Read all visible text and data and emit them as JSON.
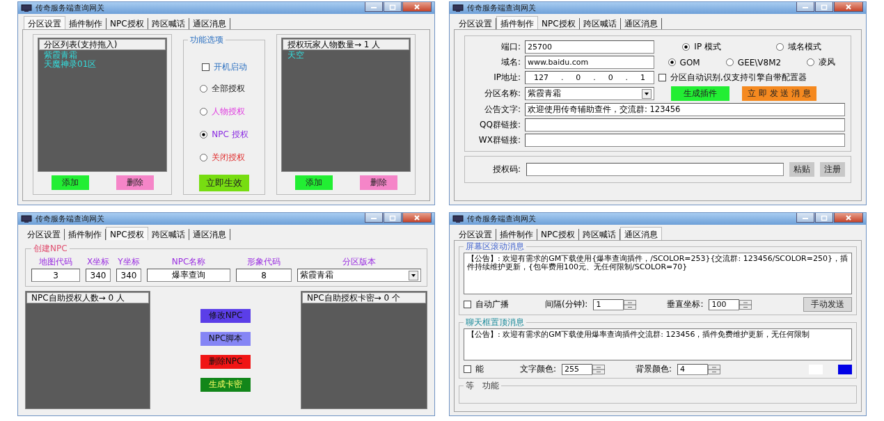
{
  "windows": [
    {
      "kind": "partition",
      "title": "传奇服务端查询网关",
      "tabs": [
        {
          "label": "分区设置",
          "selected": true
        },
        {
          "label": "插件制作",
          "selected": false
        },
        {
          "label": "NPC授权",
          "selected": false
        },
        {
          "label": "跨区喊话",
          "selected": false
        },
        {
          "label": "通区消息",
          "selected": false
        }
      ],
      "left_list": {
        "header": "分区列表(支持拖入)",
        "items": [
          "紫霞青霜",
          "天魔神录01区"
        ],
        "buttons": [
          {
            "label": "添加",
            "color": "#22ee33"
          },
          {
            "label": "删除",
            "color": "#f585c8"
          }
        ]
      },
      "options": {
        "title": "功能选项",
        "checkbox": {
          "label": "开机启动",
          "checked": false
        },
        "radios": [
          {
            "label": "全部授权",
            "selected": false,
            "color": "#222222"
          },
          {
            "label": "人物授权",
            "selected": false,
            "color": "#e040e0"
          },
          {
            "label": "NPC 授权",
            "selected": true,
            "color": "#8a2be2"
          },
          {
            "label": "关闭授权",
            "selected": false,
            "color": "#e03030"
          }
        ],
        "apply": "立即生效"
      },
      "right_list": {
        "header": "授权玩家人物数量→ 1 人",
        "items": [
          "天空"
        ],
        "buttons": [
          {
            "label": "添加",
            "color": "#22ee33"
          },
          {
            "label": "删除",
            "color": "#f585c8"
          }
        ]
      }
    },
    {
      "kind": "plugin",
      "title": "传奇服务端查询网关",
      "tabs": [
        {
          "label": "分区设置",
          "selected": false
        },
        {
          "label": "插件制作",
          "selected": true
        },
        {
          "label": "NPC授权",
          "selected": false
        },
        {
          "label": "跨区喊话",
          "selected": false
        },
        {
          "label": "通区消息",
          "selected": false
        }
      ],
      "port": {
        "label": "端口:",
        "value": "25700"
      },
      "modes": [
        {
          "label": "IP 模式",
          "selected": true
        },
        {
          "label": "域名模式",
          "selected": false
        }
      ],
      "domain": {
        "label": "域名:",
        "value": "www.baidu.com"
      },
      "engines": [
        {
          "label": "GOM",
          "selected": true
        },
        {
          "label": "GEE\\V8M2",
          "selected": false
        },
        {
          "label": "凌风",
          "selected": false
        }
      ],
      "ip": {
        "label": "IP地址:",
        "parts": [
          "127",
          "0",
          "0",
          "1"
        ],
        "separator": "."
      },
      "auto_detect": {
        "label": "分区自动识别,仅支持引擎自带配置器",
        "checked": false
      },
      "partition": {
        "label": "分区名称:",
        "value": "紫霞青霜"
      },
      "actions": [
        {
          "label": "生成插件",
          "color": "#22ee33"
        },
        {
          "label": "立 即 发 送 消 息",
          "color": "#f5891f"
        }
      ],
      "notice": {
        "label": "公告文字:",
        "value": "欢迎使用传奇辅助查件，交流群: 123456"
      },
      "qq": {
        "label": "QQ群链接:"
      },
      "wx": {
        "label": "WX群链接:"
      },
      "auth": {
        "label": "授权码:",
        "buttons": [
          "粘贴",
          "注册"
        ]
      }
    },
    {
      "kind": "npc",
      "title": "传奇服务端查询网关",
      "tabs": [
        {
          "label": "分区设置",
          "selected": false
        },
        {
          "label": "插件制作",
          "selected": false
        },
        {
          "label": "NPC授权",
          "selected": true
        },
        {
          "label": "跨区喊话",
          "selected": false
        },
        {
          "label": "通区消息",
          "selected": false
        }
      ],
      "create": {
        "title": "创建NPC",
        "fields": [
          {
            "label": "地图代码",
            "value": "3",
            "kind": "text"
          },
          {
            "label": "X坐标",
            "value": "340",
            "kind": "text"
          },
          {
            "label": "Y坐标",
            "value": "340",
            "kind": "text"
          },
          {
            "label": "NPC名称",
            "value": "爆率查询",
            "kind": "text"
          },
          {
            "label": "形象代码",
            "value": "8",
            "kind": "text"
          },
          {
            "label": "分区版本",
            "value": "紫霞青霜",
            "kind": "select"
          }
        ]
      },
      "left_list": {
        "header": "NPC自助授权人数→ 0 人"
      },
      "buttons": [
        {
          "label": "修改NPC",
          "color": "#5b3ee8"
        },
        {
          "label": "NPC脚本",
          "color": "#8585f5"
        },
        {
          "label": "删除NPC",
          "color": "#f01515"
        },
        {
          "label": "生成卡密",
          "color": "#12861a"
        }
      ],
      "right_list": {
        "header": "NPC自助授权卡密→ 0 个"
      }
    },
    {
      "kind": "message",
      "title": "传奇服务端查询网关",
      "tabs": [
        {
          "label": "分区设置",
          "selected": false
        },
        {
          "label": "插件制作",
          "selected": false
        },
        {
          "label": "NPC授权",
          "selected": false
        },
        {
          "label": "跨区喊话",
          "selected": false
        },
        {
          "label": "通区消息",
          "selected": true
        }
      ],
      "scroll": {
        "title": "屏幕区滚动消息",
        "text": "【公告】: 欢迎有需求的GM下载使用{爆率查询插件，/SCOLOR=253}{交流群: 123456/SCOLOR=250}，插件持续维护更新，{包年费用100元、无任何限制/SCOLOR=70}",
        "checkbox": {
          "label": "自动广播",
          "checked": false
        },
        "spins": [
          {
            "label": "间隔(分钟):",
            "value": "1"
          },
          {
            "label": "垂直坐标:",
            "value": "100"
          }
        ],
        "button": "手动发送"
      },
      "pinned": {
        "title": "聊天框置顶消息",
        "text": "【公告】: 欢迎有需求的GM下载使用爆率查询插件交流群: 123456，插件免费维护更新，无任何限制",
        "checkbox": {
          "label": "能",
          "checked": false
        },
        "spins": [
          {
            "label": "文字颜色:",
            "value": "255"
          },
          {
            "label": "背景颜色:",
            "value": "4"
          }
        ],
        "swatches": [
          {
            "color": "#ffffff"
          },
          {
            "color": "#0000e6"
          }
        ]
      },
      "other": {
        "title": "等　功能"
      }
    }
  ]
}
